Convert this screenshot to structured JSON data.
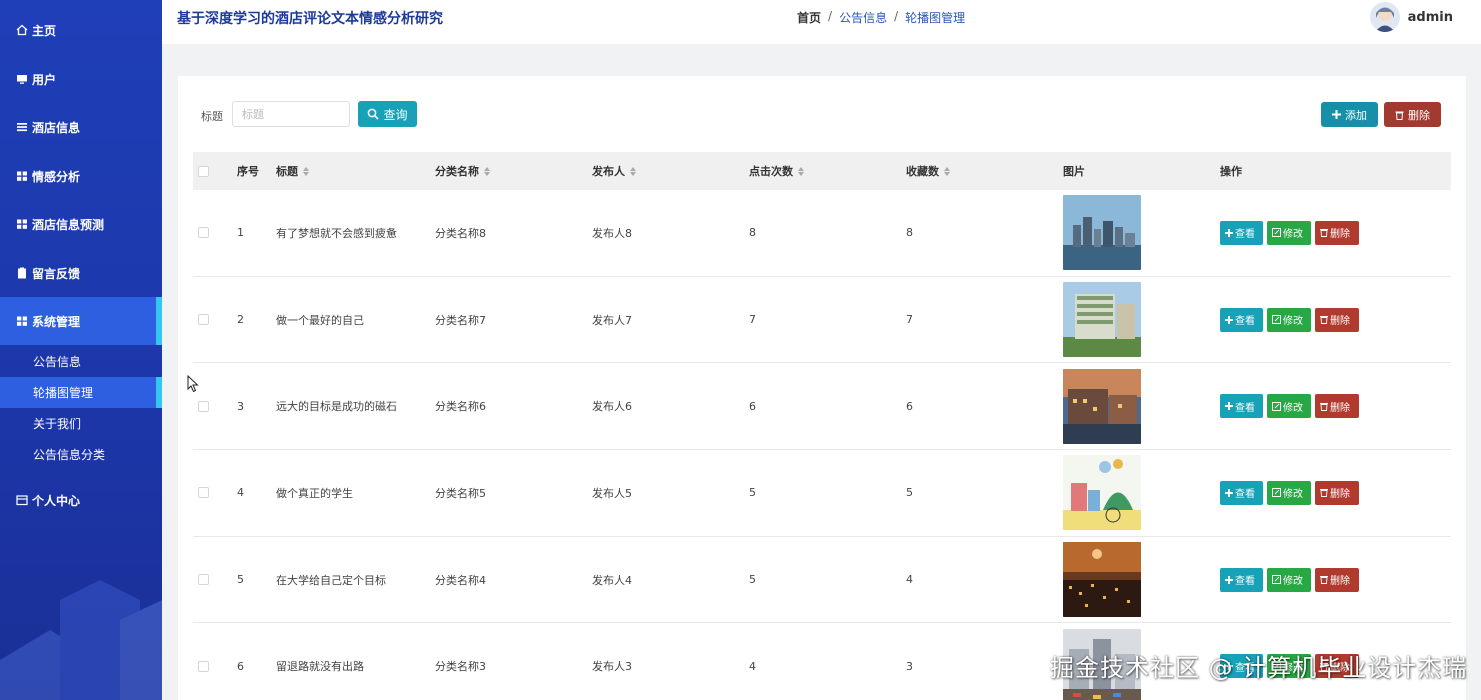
{
  "sidebar": {
    "items": [
      {
        "label": "主页",
        "icon": "home-icon"
      },
      {
        "label": "用户",
        "icon": "monitor-icon"
      },
      {
        "label": "酒店信息",
        "icon": "list-icon"
      },
      {
        "label": "情感分析",
        "icon": "grid-icon"
      },
      {
        "label": "酒店信息预测",
        "icon": "grid-icon"
      },
      {
        "label": "留言反馈",
        "icon": "clipboard-icon"
      },
      {
        "label": "系统管理",
        "icon": "grid-icon"
      },
      {
        "label": "个人中心",
        "icon": "card-icon"
      }
    ],
    "subitems": [
      {
        "label": "公告信息"
      },
      {
        "label": "轮播图管理"
      },
      {
        "label": "关于我们"
      },
      {
        "label": "公告信息分类"
      }
    ]
  },
  "header": {
    "title": "基于深度学习的酒店评论文本情感分析研究",
    "breadcrumb": [
      "首页",
      "/",
      "公告信息",
      "/",
      "轮播图管理"
    ],
    "username": "admin"
  },
  "search": {
    "label": "标题",
    "placeholder": "标题",
    "query_label": "查询"
  },
  "toolbar": {
    "add_label": "添加",
    "delete_label": "删除"
  },
  "table": {
    "columns": [
      "序号",
      "标题",
      "分类名称",
      "发布人",
      "点击次数",
      "收藏数",
      "图片",
      "操作"
    ],
    "rows": [
      {
        "no": "1",
        "title": "有了梦想就不会感到疲惫",
        "category": "分类名称8",
        "publisher": "发布人8",
        "clicks": "8",
        "favorites": "8",
        "image": "city-skyline"
      },
      {
        "no": "2",
        "title": "做一个最好的自己",
        "category": "分类名称7",
        "publisher": "发布人7",
        "clicks": "7",
        "favorites": "7",
        "image": "apartment-building"
      },
      {
        "no": "3",
        "title": "远大的目标是成功的磁石",
        "category": "分类名称6",
        "publisher": "发布人6",
        "clicks": "6",
        "favorites": "6",
        "image": "dusk-street"
      },
      {
        "no": "4",
        "title": "做个真正的学生",
        "category": "分类名称5",
        "publisher": "发布人5",
        "clicks": "5",
        "favorites": "5",
        "image": "illustrated-town"
      },
      {
        "no": "5",
        "title": "在大学给自己定个目标",
        "category": "分类名称4",
        "publisher": "发布人4",
        "clicks": "5",
        "favorites": "4",
        "image": "night-city"
      },
      {
        "no": "6",
        "title": "留退路就没有出路",
        "category": "分类名称3",
        "publisher": "发布人3",
        "clicks": "4",
        "favorites": "3",
        "image": "street-scene"
      }
    ],
    "actions": {
      "view": "查看",
      "edit": "修改",
      "delete": "删除"
    }
  },
  "watermark": "掘金技术社区 @ 计算机毕业设计杰瑞",
  "colors": {
    "sidebar": "#1f3fb8",
    "active": "#2e5fe0",
    "accent": "#33c6f0",
    "teal": "#17a2b8",
    "green": "#28a745",
    "red": "#b03a2e"
  }
}
